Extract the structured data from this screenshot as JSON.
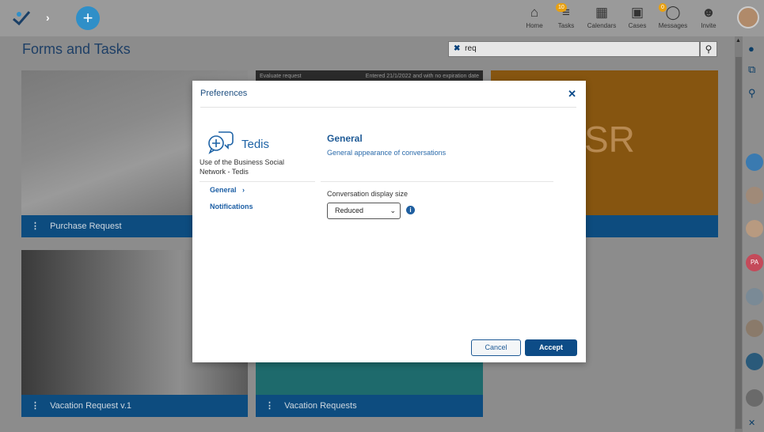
{
  "nav": {
    "items": [
      {
        "label": "Home",
        "icon": "home-icon"
      },
      {
        "label": "Tasks",
        "icon": "tasks-icon",
        "badge": "10"
      },
      {
        "label": "Calendars",
        "icon": "calendar-icon"
      },
      {
        "label": "Cases",
        "icon": "briefcase-icon"
      },
      {
        "label": "Messages",
        "icon": "messages-icon",
        "badge": "0"
      },
      {
        "label": "Invite",
        "icon": "invite-icon"
      }
    ]
  },
  "page": {
    "title": "Forms and Tasks",
    "search_value": "req"
  },
  "tiles": [
    {
      "label": "Purchase Request"
    },
    {
      "label": "",
      "header_left": "Evaluate request",
      "header_right": "Entered 21/1/2022 and with no expiration date"
    },
    {
      "label": "",
      "big_text": "SR"
    },
    {
      "label": "Vacation Request v.1"
    },
    {
      "label": "Vacation Requests"
    }
  ],
  "sidebar": {
    "avatar_initials": "PA"
  },
  "modal": {
    "title": "Preferences",
    "app_name": "Tedis",
    "app_description": "Use of the Business Social Network - Tedis",
    "menu": [
      {
        "label": "General"
      },
      {
        "label": "Notifications"
      }
    ],
    "section_title": "General",
    "section_subtitle": "General appearance of conversations",
    "field_label": "Conversation display size",
    "field_value": "Reduced",
    "cancel_label": "Cancel",
    "accept_label": "Accept"
  },
  "colors": {
    "accent": "#0d4c87",
    "link": "#1d5fa5",
    "fab": "#2f8fc8",
    "badge": "#e8a010"
  }
}
